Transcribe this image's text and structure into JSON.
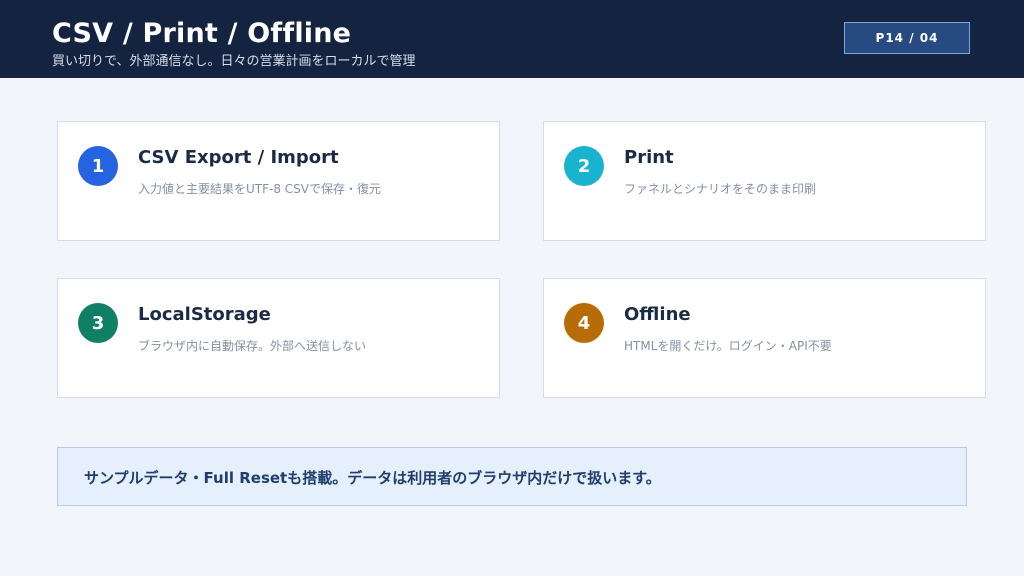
{
  "header": {
    "title": "CSV / Print / Offline",
    "subtitle": "買い切りで、外部通信なし。日々の営業計画をローカルで管理",
    "page_badge": "P14 / 04"
  },
  "cards": [
    {
      "number": "1",
      "title": "CSV Export / Import",
      "description": "入力値と主要結果をUTF-8 CSVで保存・復元",
      "color": "#2563e0"
    },
    {
      "number": "2",
      "title": "Print",
      "description": "ファネルとシナリオをそのまま印刷",
      "color": "#19b2cf"
    },
    {
      "number": "3",
      "title": "LocalStorage",
      "description": "ブラウザ内に自動保存。外部へ送信しない",
      "color": "#0f7f66"
    },
    {
      "number": "4",
      "title": "Offline",
      "description": "HTMLを開くだけ。ログイン・API不要",
      "color": "#b86c07"
    }
  ],
  "note": {
    "text": "サンプルデータ・Full Resetも搭載。データは利用者のブラウザ内だけで扱います。"
  },
  "colors": {
    "header_bg": "#14233f",
    "page_bg": "#f2f6fb",
    "note_bg": "#e6f0fc"
  }
}
